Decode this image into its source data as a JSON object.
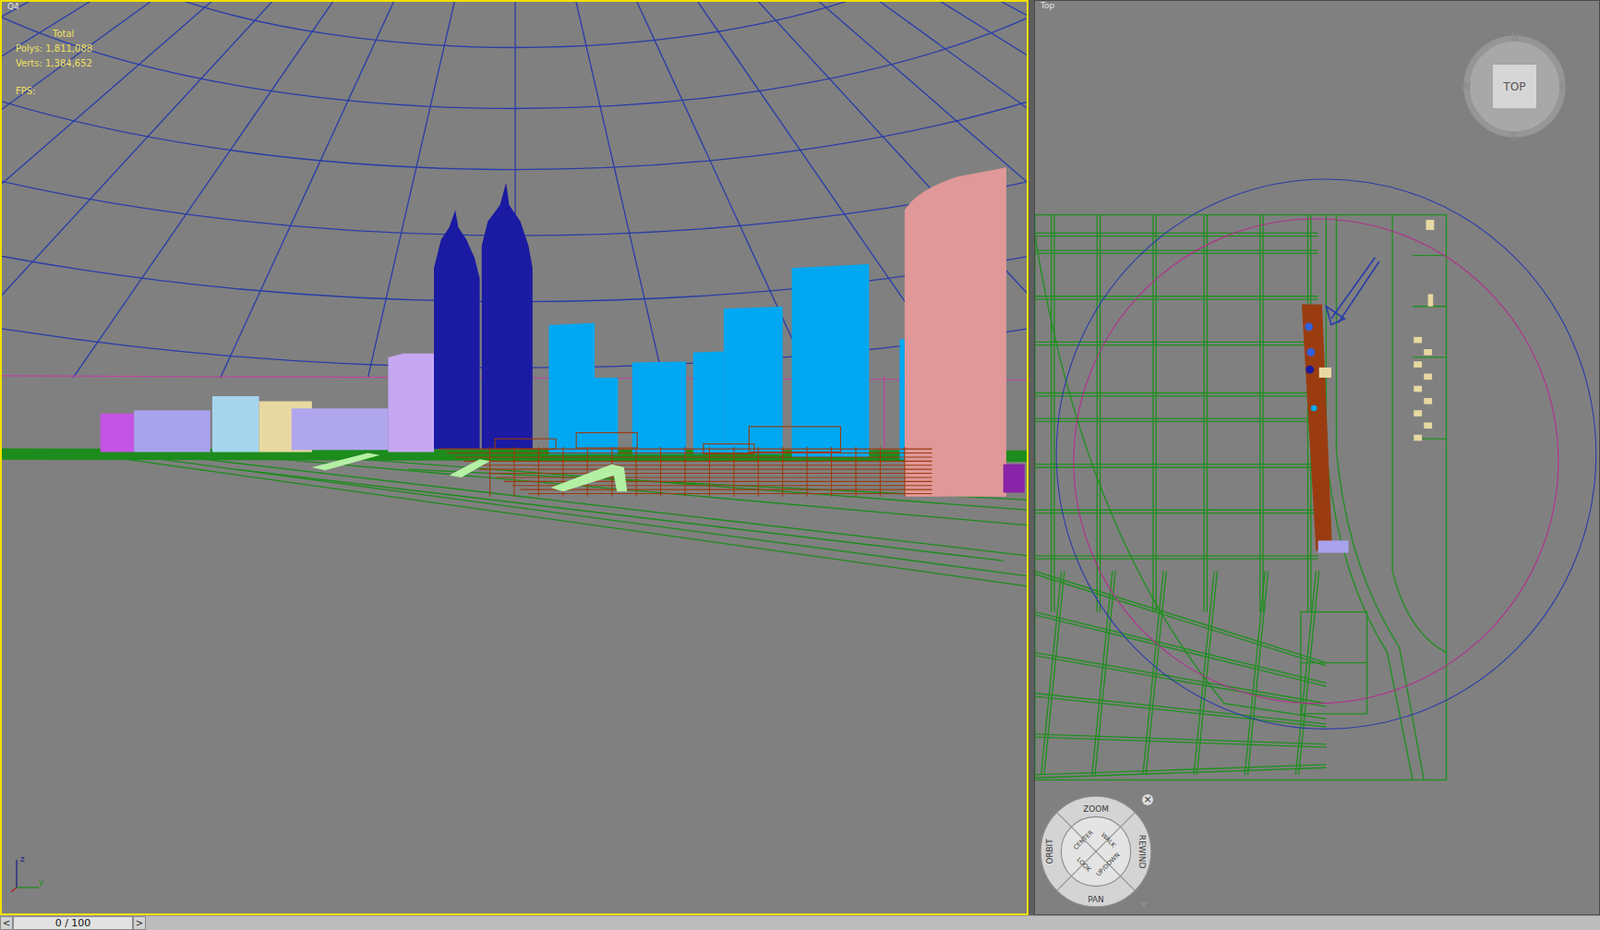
{
  "viewports": [
    {
      "label": "Q4",
      "active": true,
      "stats": {
        "title": "Total",
        "lines": [
          "Polys: 1,811,088",
          "Verts: 1,384,652"
        ],
        "fps": "FPS:"
      },
      "axes": [
        "z",
        "y"
      ]
    },
    {
      "label": "Top",
      "active": false
    }
  ],
  "viewcube": {
    "face": "TOP",
    "compass": [
      "N",
      "E",
      "S",
      "W"
    ]
  },
  "nav_wheel": {
    "items": [
      {
        "label": "ZOOM",
        "kind": "outer"
      },
      {
        "label": "REWIND",
        "kind": "outer"
      },
      {
        "label": "PAN",
        "kind": "outer"
      },
      {
        "label": "ORBIT",
        "kind": "outer"
      },
      {
        "label": "CENTER",
        "kind": "inner"
      },
      {
        "label": "WALK",
        "kind": "inner"
      },
      {
        "label": "UP/DOWN",
        "kind": "inner"
      },
      {
        "label": "LOOK",
        "kind": "inner"
      }
    ],
    "close": "×"
  },
  "timeline": {
    "prev": "<",
    "next": ">",
    "frame": "0 / 100",
    "level": 0
  }
}
